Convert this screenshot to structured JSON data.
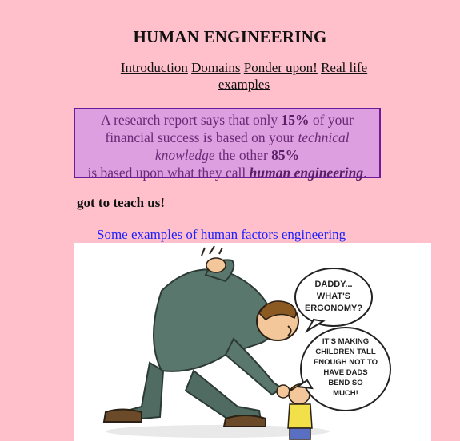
{
  "header": {
    "title": "HUMAN ENGINEERING"
  },
  "nav": {
    "introduction": "Introduction",
    "domains": "Domains",
    "ponder": "Ponder upon!",
    "real_life": "Real life examples"
  },
  "quote": {
    "part1": "A research report says that only ",
    "pct1": "15%",
    "part2": " of your financial success is based on your ",
    "tech": "technical knowledge",
    "part3": " the other ",
    "pct2": "85%",
    "part4": "is based upon what they call ",
    "he": "human engineering",
    "end": "."
  },
  "tagline": "got to teach us!",
  "examples_link": "Some examples of human factors engineering",
  "cartoon": {
    "bubble1": [
      "DADDY...",
      "WHAT'S",
      "ERGONOMY?"
    ],
    "bubble2": [
      "IT'S MAKING",
      "CHILDREN TALL",
      "ENOUGH NOT TO",
      "HAVE DADS",
      "BEND SO",
      "MUCH!"
    ]
  }
}
